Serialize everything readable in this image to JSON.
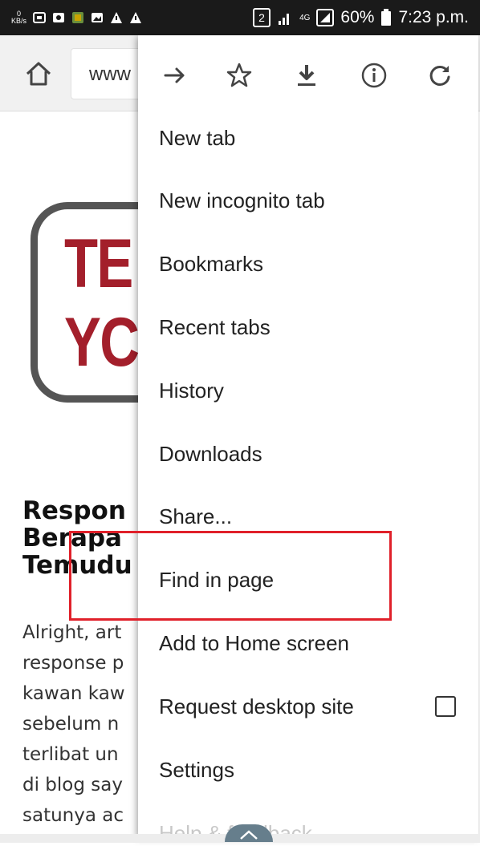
{
  "status_bar": {
    "net_speed": "0\nKB/s",
    "sim_badge": "2",
    "network": "4G",
    "battery": "60%",
    "time": "7:23 p.m."
  },
  "toolbar": {
    "url": "www"
  },
  "page": {
    "logo_line1": "TE",
    "logo_line2": "YC",
    "title": "Respon\nBerapa\nTemudu",
    "body": "Alright, art\nresponse p\nkawan kaw\nsebelum n\nterlibat un\ndi blog say\nsatunya ac"
  },
  "menu": {
    "icons": [
      "forward-icon",
      "bookmark-star-icon",
      "download-icon",
      "info-icon",
      "refresh-icon"
    ],
    "items": [
      {
        "label": "New tab"
      },
      {
        "label": "New incognito tab"
      },
      {
        "label": "Bookmarks"
      },
      {
        "label": "Recent tabs"
      },
      {
        "label": "History"
      },
      {
        "label": "Downloads"
      },
      {
        "label": "Share..."
      },
      {
        "label": "Find in page"
      },
      {
        "label": "Add to Home screen"
      },
      {
        "label": "Request desktop site"
      },
      {
        "label": "Settings"
      },
      {
        "label": "Help & feedback"
      }
    ]
  },
  "colors": {
    "highlight": "#e0202a",
    "logo_red": "#a31f2b"
  }
}
